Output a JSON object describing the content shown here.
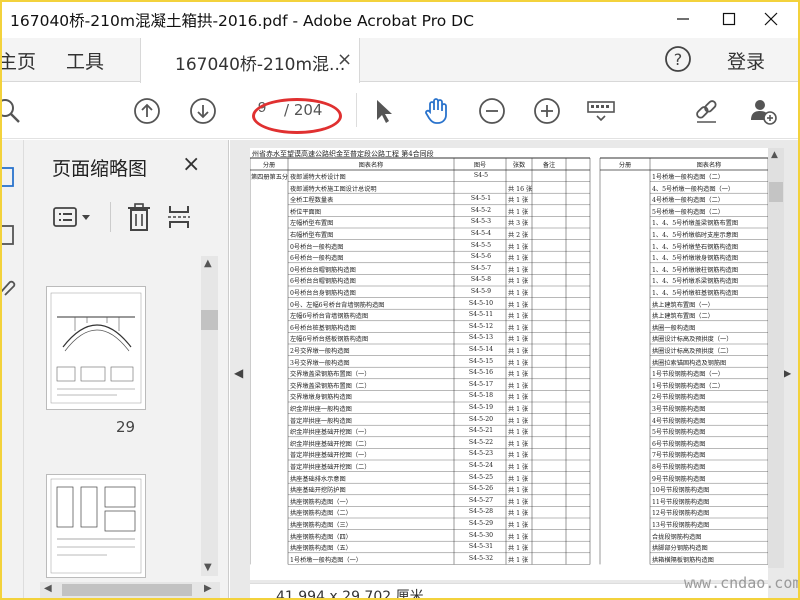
{
  "window": {
    "title": "167040桥-210m混凝土箱拱-2016.pdf - Adobe Acrobat Pro DC"
  },
  "menubar": {
    "home_label": "主页",
    "tools_label": "工具",
    "login_label": "登录"
  },
  "tab": {
    "label": "167040桥-210m混...",
    "close": "×"
  },
  "toolbar": {
    "page_current": "9",
    "page_total": "/ 204"
  },
  "thumbnails": {
    "title": "页面缩略图",
    "close": "×",
    "page_label": "29"
  },
  "document": {
    "header": "州省赤水至望谟高速公路织金至普定段公路工程 第4合同段",
    "left_columns": [
      "分册",
      "图表名称",
      "图号",
      "张数",
      "备注"
    ],
    "right_columns": [
      "分册",
      "图表名称"
    ],
    "left_rows": [
      {
        "vol": "第四册第五分册",
        "name": "夜郎湖特大桥设计图",
        "code": "S4-5",
        "count": "",
        "note": ""
      },
      {
        "vol": "",
        "name": "夜郎湖特大桥施工图设计总说明",
        "code": "",
        "count": "共 16 张",
        "note": ""
      },
      {
        "vol": "",
        "name": "全桥工程数量表",
        "code": "S4-5-1",
        "count": "共 1 张",
        "note": ""
      },
      {
        "vol": "",
        "name": "桥位平面图",
        "code": "S4-5-2",
        "count": "共 1 张",
        "note": ""
      },
      {
        "vol": "",
        "name": "左幅桥型布置图",
        "code": "S4-5-3",
        "count": "共 3 张",
        "note": ""
      },
      {
        "vol": "",
        "name": "右幅桥型布置图",
        "code": "S4-5-4",
        "count": "共 2 张",
        "note": ""
      },
      {
        "vol": "",
        "name": "0号桥台一般构造图",
        "code": "S4-5-5",
        "count": "共 1 张",
        "note": ""
      },
      {
        "vol": "",
        "name": "6号桥台一般构造图",
        "code": "S4-5-6",
        "count": "共 1 张",
        "note": ""
      },
      {
        "vol": "",
        "name": "0号桥台台帽钢筋构造图",
        "code": "S4-5-7",
        "count": "共 1 张",
        "note": ""
      },
      {
        "vol": "",
        "name": "6号桥台台帽钢筋构造图",
        "code": "S4-5-8",
        "count": "共 1 张",
        "note": ""
      },
      {
        "vol": "",
        "name": "0号桥台台身钢筋构造图",
        "code": "S4-5-9",
        "count": "共 1 张",
        "note": ""
      },
      {
        "vol": "",
        "name": "0号、左幅6号桥台背墙钢筋构造图",
        "code": "S4-5-10",
        "count": "共 1 张",
        "note": ""
      },
      {
        "vol": "",
        "name": "左幅6号桥台背墙钢筋构造图",
        "code": "S4-5-11",
        "count": "共 1 张",
        "note": ""
      },
      {
        "vol": "",
        "name": "6号桥台桩基钢筋构造图",
        "code": "S4-5-12",
        "count": "共 1 张",
        "note": ""
      },
      {
        "vol": "",
        "name": "左幅6号桥台搭板钢筋构造图",
        "code": "S4-5-13",
        "count": "共 1 张",
        "note": ""
      },
      {
        "vol": "",
        "name": "2号交界墩一般构造图",
        "code": "S4-5-14",
        "count": "共 1 张",
        "note": ""
      },
      {
        "vol": "",
        "name": "3号交界墩一般构造图",
        "code": "S4-5-15",
        "count": "共 1 张",
        "note": ""
      },
      {
        "vol": "",
        "name": "交界墩盖梁钢筋布置图（一）",
        "code": "S4-5-16",
        "count": "共 1 张",
        "note": ""
      },
      {
        "vol": "",
        "name": "交界墩盖梁钢筋布置图（二）",
        "code": "S4-5-17",
        "count": "共 1 张",
        "note": ""
      },
      {
        "vol": "",
        "name": "交界墩墩身钢筋构造图",
        "code": "S4-5-18",
        "count": "共 1 张",
        "note": ""
      },
      {
        "vol": "",
        "name": "织金岸拱座一般构造图",
        "code": "S4-5-19",
        "count": "共 1 张",
        "note": ""
      },
      {
        "vol": "",
        "name": "普定岸拱座一般构造图",
        "code": "S4-5-20",
        "count": "共 1 张",
        "note": ""
      },
      {
        "vol": "",
        "name": "织金岸拱座基础开挖图（一）",
        "code": "S4-5-21",
        "count": "共 1 张",
        "note": ""
      },
      {
        "vol": "",
        "name": "织金岸拱座基础开挖图（二）",
        "code": "S4-5-22",
        "count": "共 1 张",
        "note": ""
      },
      {
        "vol": "",
        "name": "普定岸拱座基础开挖图（一）",
        "code": "S4-5-23",
        "count": "共 1 张",
        "note": ""
      },
      {
        "vol": "",
        "name": "普定岸拱座基础开挖图（二）",
        "code": "S4-5-24",
        "count": "共 1 张",
        "note": ""
      },
      {
        "vol": "",
        "name": "拱座基础排水示意图",
        "code": "S4-5-25",
        "count": "共 1 张",
        "note": ""
      },
      {
        "vol": "",
        "name": "拱座基础开挖防护图",
        "code": "S4-5-26",
        "count": "共 1 张",
        "note": ""
      },
      {
        "vol": "",
        "name": "拱座钢筋构造图（一）",
        "code": "S4-5-27",
        "count": "共 1 张",
        "note": ""
      },
      {
        "vol": "",
        "name": "拱座钢筋构造图（二）",
        "code": "S4-5-28",
        "count": "共 1 张",
        "note": ""
      },
      {
        "vol": "",
        "name": "拱座钢筋构造图（三）",
        "code": "S4-5-29",
        "count": "共 1 张",
        "note": ""
      },
      {
        "vol": "",
        "name": "拱座钢筋构造图（四）",
        "code": "S4-5-30",
        "count": "共 1 张",
        "note": ""
      },
      {
        "vol": "",
        "name": "拱座钢筋构造图（五）",
        "code": "S4-5-31",
        "count": "共 1 张",
        "note": ""
      },
      {
        "vol": "",
        "name": "1号桥墩一般构造图（一）",
        "code": "S4-5-32",
        "count": "共 1 张",
        "note": ""
      }
    ],
    "right_rows": [
      "1号桥墩一般构造图（二）",
      "4、5号桥墩一般构造图（一）",
      "4号桥墩一般构造图（二）",
      "5号桥墩一般构造图（二）",
      "1、4、5号桥墩盖梁钢筋布置图",
      "1、4、5号桥墩临时支座示意图",
      "1、4、5号桥墩垫石钢筋构造图",
      "1、4、5号桥墩墩身钢筋构造图",
      "1、4、5号桥墩墩柱钢筋构造图",
      "1、4、5号桥墩系梁钢筋构造图",
      "1、4、5号桥墩桩基钢筋构造图",
      "拱上建筑布置图（一）",
      "拱上建筑布置图（二）",
      "拱圈一般构造图",
      "拱圈设计标高及预拱度（一）",
      "拱圈设计标高及预拱度（二）",
      "拱圈拉索锚固构造及钢筋图",
      "1号节段钢筋构造图（一）",
      "1号节段钢筋构造图（二）",
      "2号节段钢筋构造图",
      "3号节段钢筋构造图",
      "4号节段钢筋构造图",
      "5号节段钢筋构造图",
      "6号节段钢筋构造图",
      "7号节段钢筋构造图",
      "8号节段钢筋构造图",
      "9号节段钢筋构造图",
      "10号节段钢筋构造图",
      "11号节段钢筋构造图",
      "12号节段钢筋构造图",
      "13号节段钢筋构造图",
      "合拢段钢筋构造图",
      "拱脚部分钢筋构造图",
      "拱箱横隔板钢筋构造图"
    ]
  },
  "status": {
    "dimensions": "41.994 x 29.702 厘米"
  },
  "watermark": "www.cndao.com",
  "colors": {
    "accent": "#2a73cc",
    "annotation": "#e03030",
    "frame": "#f3d23c"
  },
  "icons": [
    "previous-page-icon",
    "next-page-icon",
    "select-cursor-icon",
    "hand-tool-icon",
    "zoom-out-icon",
    "zoom-in-icon",
    "keyboard-icon",
    "link-tool-icon",
    "share-user-icon",
    "help-icon",
    "options-menu-icon",
    "delete-icon",
    "extract-icon"
  ]
}
